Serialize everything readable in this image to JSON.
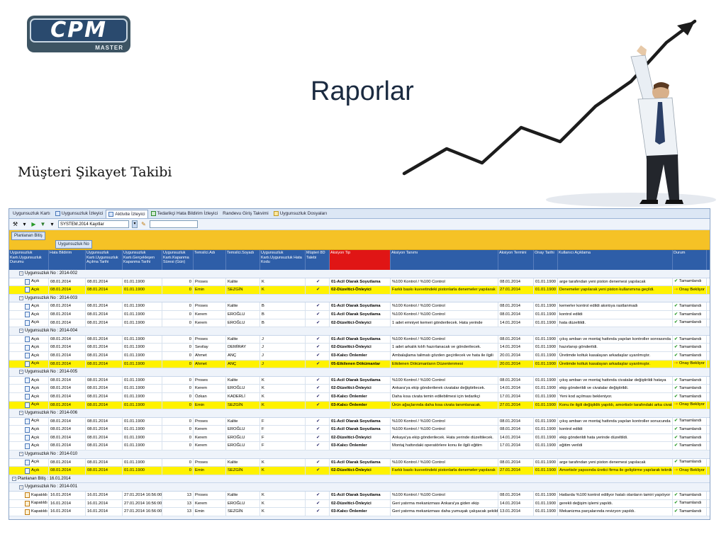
{
  "slide": {
    "title": "Raporlar",
    "subtitle": "Müşteri Şikayet Takibi",
    "logo_text": "CPM",
    "logo_sub": "MASTER"
  },
  "colors": {
    "accent_header": "#2e5ea8",
    "highlight": "#fff200",
    "group_bar": "#f5c226",
    "action_type_header": "#e01515"
  },
  "tabs": [
    {
      "label": "Uygunsuzluk Kartı",
      "icon": "none"
    },
    {
      "label": "Uygunsuzluk İzleyici",
      "icon": "document-icon"
    },
    {
      "label": "Aktivite İzleyici",
      "icon": "activity-icon",
      "active": true
    },
    {
      "label": "Tedarikçi Hata Bildirim İzleyici",
      "icon": "people-icon"
    },
    {
      "label": "Randevu Giriş Takvimi",
      "icon": "none"
    },
    {
      "label": "Uygunsuzluk Dosyaları",
      "icon": "folder-icon"
    }
  ],
  "toolbar": {
    "filter_value": "SYSTEM.2014 Kayıtlar"
  },
  "group_chips": {
    "first": "Planlanan Bitiş",
    "second": "Uygunsuzluk No"
  },
  "columns": [
    "Uygunsuzluk Kartı.Uygunsuzluk Durumu",
    "Hata Bildirim",
    "Uygunsuzluk Kartı.Uygunsuzluk Açılma Tarihi",
    "Uygunsuzluk Kartı.Gerçekleşen Kapanma Tarihi",
    "Uygunsuzluk Kartı.Kapanma Süresi (Gün)",
    "Temsilci.Adı",
    "Temsilci.Soyadı",
    "Uygunsuzluk Kartı.Uygunsuzluk Hata Kodu",
    "Müşteri 8D Talebi",
    "Aksiyon Tip",
    "Aksiyon Tanımı",
    "Aksiyon Termini",
    "Onay Tarihi",
    "Kullanıcı Açıklama",
    "Durum"
  ],
  "rows": [
    {
      "type": "group",
      "level": 2,
      "label": "Uygunsuzluk No : 2014-002"
    },
    {
      "type": "row",
      "c": [
        "Açık",
        "08.01.2014",
        "08.01.2014",
        "01.01.1900",
        "0",
        "Proses",
        "Kalite",
        "K",
        "✔",
        "01-Acil Olarak Soyutlama",
        "%100 Kontrol / %100 Control",
        "08.01.2014",
        "01.01.1900",
        "arge tarafından yeni piston denemesi yapılacak",
        "Tamamlandı"
      ],
      "status": "ok"
    },
    {
      "type": "row",
      "hl": true,
      "c": [
        "Açık",
        "08.01.2014",
        "08.01.2014",
        "01.01.1900",
        "0",
        "Emin",
        "SEZGİN",
        "K",
        "✔",
        "02-Düzeltici-Önleyici",
        "Farklı baskı kuvvetindeki pistonlarla denemeler yapılarak",
        "27.01.2014",
        "01.01.1900",
        "Denemeler yapılarak yeni piston kullanımına geçildi.",
        "Onay Bekliyor"
      ],
      "status": "wait"
    },
    {
      "type": "group",
      "level": 2,
      "label": "Uygunsuzluk No : 2014-003"
    },
    {
      "type": "row",
      "c": [
        "Açık",
        "08.01.2014",
        "08.01.2014",
        "01.01.1900",
        "0",
        "Proses",
        "Kalite",
        "B",
        "✔",
        "01-Acil Olarak Soyutlama",
        "%100 Kontrol / %100 Control",
        "08.01.2014",
        "01.01.1900",
        "kemerler kontrol edildi akıntıya rastlanmadı",
        "Tamamlandı"
      ],
      "status": "ok"
    },
    {
      "type": "row",
      "c": [
        "Açık",
        "08.01.2014",
        "08.01.2014",
        "01.01.1900",
        "0",
        "Kerem",
        "EROĞLU",
        "B",
        "✔",
        "01-Acil Olarak Soyutlama",
        "%100 Kontrol / %100 Control",
        "08.01.2014",
        "01.01.1900",
        "kontrol edildi",
        "Tamamlandı"
      ],
      "status": "ok"
    },
    {
      "type": "row",
      "c": [
        "Açık",
        "08.01.2014",
        "08.01.2014",
        "01.01.1900",
        "0",
        "Kerem",
        "EROĞLU",
        "B",
        "✔",
        "02-Düzeltici-Önleyici",
        "1 adet emniyet kemeri gönderilecek. Hata yerinde",
        "14.01.2014",
        "01.01.1900",
        "hata düzeltildi.",
        "Tamamlandı"
      ],
      "status": "ok"
    },
    {
      "type": "group",
      "level": 2,
      "label": "Uygunsuzluk No : 2014-004"
    },
    {
      "type": "row",
      "c": [
        "Açık",
        "08.01.2014",
        "08.01.2014",
        "01.01.1900",
        "0",
        "Proses",
        "Kalite",
        "J",
        "✔",
        "01-Acil Olarak Soyutlama",
        "%100 Kontrol / %100 Control",
        "08.01.2014",
        "01.01.1900",
        "çıkış ambarı ve montaj hattında yapılan kontroller sonrasında",
        "Tamamlandı"
      ],
      "status": "ok"
    },
    {
      "type": "row",
      "c": [
        "Açık",
        "08.01.2014",
        "08.01.2014",
        "01.01.1900",
        "0",
        "Sevilay",
        "DEMİRAY",
        "J",
        "✔",
        "02-Düzeltici-Önleyici",
        "1 adet arkalık kılıfı hazırlanacak ve gönderilecek.",
        "14.01.2014",
        "01.01.1900",
        "hazırlanıp gönderildi.",
        "Tamamlandı"
      ],
      "status": "ok"
    },
    {
      "type": "row",
      "c": [
        "Açık",
        "08.01.2014",
        "08.01.2014",
        "01.01.1900",
        "0",
        "Ahmet",
        "ANÇ",
        "J",
        "✔",
        "03-Kalıcı Önlemler",
        "Ambalajlama talimatı gözden geçirilecek ve hata ile ilgili",
        "20.01.2014",
        "01.01.1900",
        "Üretimde koltuk kasalayan arkadaşlar uyarılmıştır.",
        "Tamamlandı"
      ],
      "status": "ok"
    },
    {
      "type": "row",
      "hl": true,
      "ptr": true,
      "c": [
        "Açık",
        "08.01.2014",
        "08.01.2014",
        "01.01.1900",
        "0",
        "Ahmet",
        "ANÇ",
        "J",
        "✔",
        "05-Etkilenen Dökümanlar",
        "Etkilenen Dökümanların Düzenlenmesi",
        "20.01.2014",
        "01.01.1900",
        "Üretimde koltuk kasalayan arkadaşlar uyarılmıştır.",
        "Onay Bekliyor"
      ],
      "status": "wait"
    },
    {
      "type": "group",
      "level": 2,
      "label": "Uygunsuzluk No : 2014-005"
    },
    {
      "type": "row",
      "c": [
        "Açık",
        "08.01.2014",
        "08.01.2014",
        "01.01.1900",
        "0",
        "Proses",
        "Kalite",
        "K",
        "✔",
        "01-Acil Olarak Soyutlama",
        "%100 Kontrol / %100 Control",
        "08.01.2014",
        "01.01.1900",
        "çıkış ambarı ve montaj hattında civatalar değiştirildi hataya",
        "Tamamlandı"
      ],
      "status": "ok"
    },
    {
      "type": "row",
      "c": [
        "Açık",
        "08.01.2014",
        "08.01.2014",
        "01.01.1900",
        "0",
        "Kerem",
        "EROĞLU",
        "K",
        "✔",
        "02-Düzeltici-Önleyici",
        "Ankara'ya ekip gönderilerek civatalar değiştirilecek.",
        "14.01.2014",
        "01.01.1900",
        "ekip gönderildi ve civatalar değiştirildi.",
        "Tamamlandı"
      ],
      "status": "ok"
    },
    {
      "type": "row",
      "c": [
        "Açık",
        "08.01.2014",
        "08.01.2014",
        "01.01.1900",
        "0",
        "Özkan",
        "KADERLİ",
        "K",
        "✔",
        "03-Kalıcı Önlemler",
        "Daha kısa civata temin edilebilmesi için tedarikçi",
        "17.01.2014",
        "01.01.1900",
        "Yeni kod açılması bekleniyor.",
        "Tamamlandı"
      ],
      "status": "ok"
    },
    {
      "type": "row",
      "hl": true,
      "c": [
        "Açık",
        "08.01.2014",
        "08.01.2014",
        "01.01.1900",
        "0",
        "Emin",
        "SEZGİN",
        "K",
        "✔",
        "03-Kalıcı Önlemler",
        "Ürün ağaçlarında daha kısa civata tanımlanacak.",
        "27.01.2014",
        "01.01.1900",
        "Konu ile ilgili değişiklik yapıldı, amortisör tarafındaki arka civata",
        "Onay Bekliyor"
      ],
      "status": "wait"
    },
    {
      "type": "group",
      "level": 2,
      "label": "Uygunsuzluk No : 2014-006"
    },
    {
      "type": "row",
      "c": [
        "Açık",
        "08.01.2014",
        "08.01.2014",
        "01.01.1900",
        "0",
        "Proses",
        "Kalite",
        "F",
        "✔",
        "01-Acil Olarak Soyutlama",
        "%100 Kontrol / %100 Control",
        "08.01.2014",
        "01.01.1900",
        "çıkış ambarı ve montaj hattında yapılan kontroller sonucunda",
        "Tamamlandı"
      ],
      "status": "ok"
    },
    {
      "type": "row",
      "c": [
        "Açık",
        "08.01.2014",
        "08.01.2014",
        "01.01.1900",
        "0",
        "Kerem",
        "EROĞLU",
        "F",
        "✔",
        "01-Acil Olarak Soyutlama",
        "%100 Kontrol / %100 Control",
        "08.01.2014",
        "01.01.1900",
        "kontrol edildi",
        "Tamamlandı"
      ],
      "status": "ok"
    },
    {
      "type": "row",
      "c": [
        "Açık",
        "08.01.2014",
        "08.01.2014",
        "01.01.1900",
        "0",
        "Kerem",
        "EROĞLU",
        "F",
        "✔",
        "02-Düzeltici-Önleyici",
        "Ankaya'ya ekip gönderilecek. Hata yerinde düzeltilecek.",
        "14.01.2014",
        "01.01.1900",
        "ekip gönderildi hata yerinde düzeltildi.",
        "Tamamlandı"
      ],
      "status": "ok"
    },
    {
      "type": "row",
      "c": [
        "Açık",
        "08.01.2014",
        "08.01.2014",
        "01.01.1900",
        "0",
        "Kerem",
        "EROĞLU",
        "F",
        "✔",
        "03-Kalıcı Önlemler",
        "Montaj hattındaki operatörlere konu ile ilgili eğitim",
        "17.01.2014",
        "01.01.1900",
        "eğitim verildi",
        "Tamamlandı"
      ],
      "status": "ok"
    },
    {
      "type": "group",
      "level": 2,
      "label": "Uygunsuzluk No : 2014-010"
    },
    {
      "type": "row",
      "c": [
        "Açık",
        "08.01.2014",
        "08.01.2014",
        "01.01.1900",
        "0",
        "Proses",
        "Kalite",
        "K",
        "✔",
        "01-Acil Olarak Soyutlama",
        "%100 Kontrol / %100 Control",
        "08.01.2014",
        "01.01.1900",
        "arge tarafından yeni piston denemesi yapılacak",
        "Tamamlandı"
      ],
      "status": "ok"
    },
    {
      "type": "row",
      "hl": true,
      "ptr": true,
      "c": [
        "Açık",
        "08.01.2014",
        "08.01.2014",
        "01.01.1900",
        "0",
        "Emin",
        "SEZGİN",
        "K",
        "✔",
        "02-Düzeltici-Önleyici",
        "Farklı baskı kuvvetindeki pistonlarla denemeler yapılarak",
        "27.01.2014",
        "01.01.1900",
        "Amortisör yapısında üretici firma ile geliştirme yapılarak teknik",
        "Onay Bekliyor"
      ],
      "status": "wait"
    },
    {
      "type": "group",
      "level": 1,
      "label": "Planlanan Bitiş : 16.01.2014"
    },
    {
      "type": "group",
      "level": 2,
      "label": "Uygunsuzluk No : 2014-001"
    },
    {
      "type": "row",
      "orange": true,
      "c": [
        "Kapatıldı",
        "16.01.2014",
        "16.01.2014",
        "27.01.2014 16:56:00",
        "13",
        "Proses",
        "Kalite",
        "K",
        "✔",
        "01-Acil Olarak Soyutlama",
        "%100 Kontrol / %100 Control",
        "08.01.2014",
        "01.01.1900",
        "Hatlarda %100 kontrol ediliyor hatalı olanların tamiri yapılıyor",
        "Tamamlandı"
      ],
      "status": "ok"
    },
    {
      "type": "row",
      "orange": true,
      "c": [
        "Kapatıldı",
        "16.01.2014",
        "16.01.2014",
        "27.01.2014 16:56:00",
        "13",
        "Kerem",
        "EROĞLU",
        "K",
        "✔",
        "02-Düzeltici-Önleyici",
        "Geri yatırma mekanizması Ankara'ya giden ekip",
        "14.01.2014",
        "01.01.1900",
        "gerekli değişim işlemi yapıldı.",
        "Tamamlandı"
      ],
      "status": "ok"
    },
    {
      "type": "row",
      "orange": true,
      "c": [
        "Kapatıldı",
        "16.01.2014",
        "16.01.2014",
        "27.01.2014 16:56:00",
        "13",
        "Emin",
        "SEZGİN",
        "K",
        "✔",
        "03-Kalıcı Önlemler",
        "Geri yatırma mekanizması daha yumuşak çalışacak şekilde",
        "13.01.2014",
        "01.01.1900",
        "Mekanizma parçalarında revizyon yapıldı.",
        "Tamamlandı"
      ],
      "status": "ok"
    }
  ]
}
